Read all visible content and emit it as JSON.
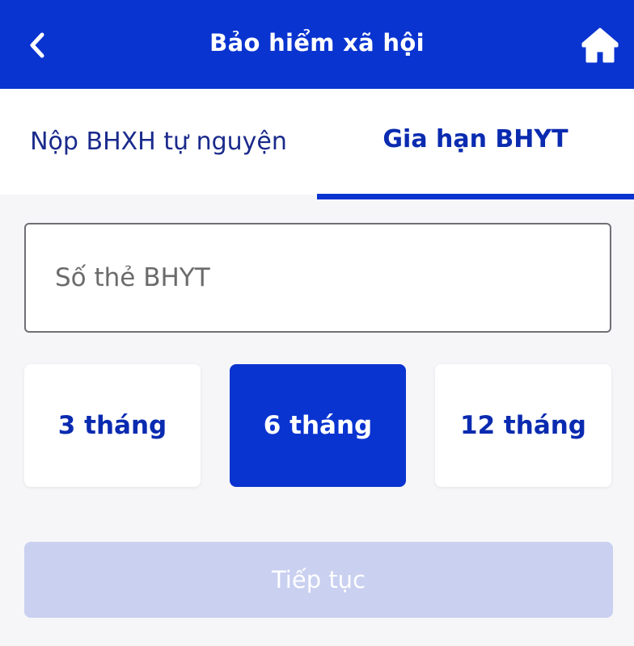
{
  "header": {
    "title": "Bảo hiểm xã hội",
    "back_icon": "chevron-left-icon",
    "home_icon": "home-icon",
    "background_color": "#0a34d0"
  },
  "tabs": [
    {
      "label": "Nộp BHXH tự nguyện",
      "active": false
    },
    {
      "label": "Gia hạn BHYT",
      "active": true
    }
  ],
  "card_input": {
    "placeholder": "Số thẻ BHYT",
    "value": ""
  },
  "duration_options": [
    {
      "label": "3 tháng",
      "selected": false
    },
    {
      "label": "6 tháng",
      "selected": true
    },
    {
      "label": "12 tháng",
      "selected": false
    }
  ],
  "continue_button": {
    "label": "Tiếp tục",
    "enabled": false
  },
  "colors": {
    "accent": "#0a34d0",
    "disabled_button": "#c9d0f0",
    "background": "#f6f6f9"
  }
}
